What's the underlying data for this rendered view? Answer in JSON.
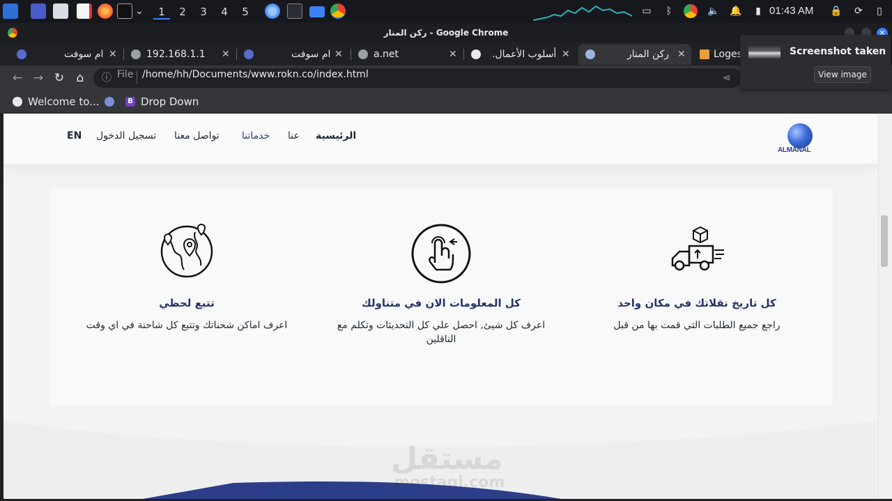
{
  "taskbar": {
    "workspaces": [
      "1",
      "2",
      "3",
      "4",
      "5"
    ],
    "clock": "01:43 AM",
    "icons": [
      "app-menu-icon",
      "desktop-icon",
      "files-icon",
      "text-editor-icon",
      "firefox-icon",
      "terminal-icon",
      "chevron-down-icon",
      "thunderbird-icon",
      "terminal-icon",
      "folder-icon",
      "chrome-icon"
    ]
  },
  "window": {
    "title": "ركن المنار - Google Chrome"
  },
  "tabs": [
    {
      "title": "ام سوفت",
      "active": false
    },
    {
      "title": "192.168.1.1",
      "active": false
    },
    {
      "title": "ام سوفت",
      "active": false
    },
    {
      "title": "a.net",
      "active": false
    },
    {
      "title": "أسلوب الأعمال.",
      "active": false
    },
    {
      "title": "ركن المنار",
      "active": true
    },
    {
      "title": "Loges",
      "active": false
    }
  ],
  "toolbar": {
    "file_label": "File",
    "url": "/home/hh/Documents/www.rokn.co/index.html"
  },
  "bookmarks": [
    {
      "label": "Welcome to..."
    },
    {
      "label": ""
    },
    {
      "label": "Drop Down"
    }
  ],
  "notification": {
    "title": "Screenshot taken",
    "button": "View image"
  },
  "site": {
    "logo_text": "ALMANAL",
    "nav": {
      "home": "الرئيسية",
      "about": "عنا",
      "services": "خدماتنا",
      "contact": "تواصل معنا",
      "login": "تسجيل الدخول",
      "lang": "EN"
    },
    "features": [
      {
        "icon": "delivery-truck-icon",
        "title": "كل تاريخ نقلاتك في مكان واحد",
        "desc": "راجع جميع الطلبات التي قمت بها من قبل"
      },
      {
        "icon": "touch-hand-icon",
        "title": "كل المعلومات الان في متناولك",
        "desc": "اعرف كل شيئ, احصل علي كل التحديثات وتكلم مع الناقلين"
      },
      {
        "icon": "globe-pin-icon",
        "title": "تتبع لحظي",
        "desc": "اعرف اماكن شحناتك وتتبع كل شاحنة في اي وقت"
      }
    ],
    "watermark": {
      "ar": "مستقل",
      "en": "mostaql.com"
    }
  }
}
